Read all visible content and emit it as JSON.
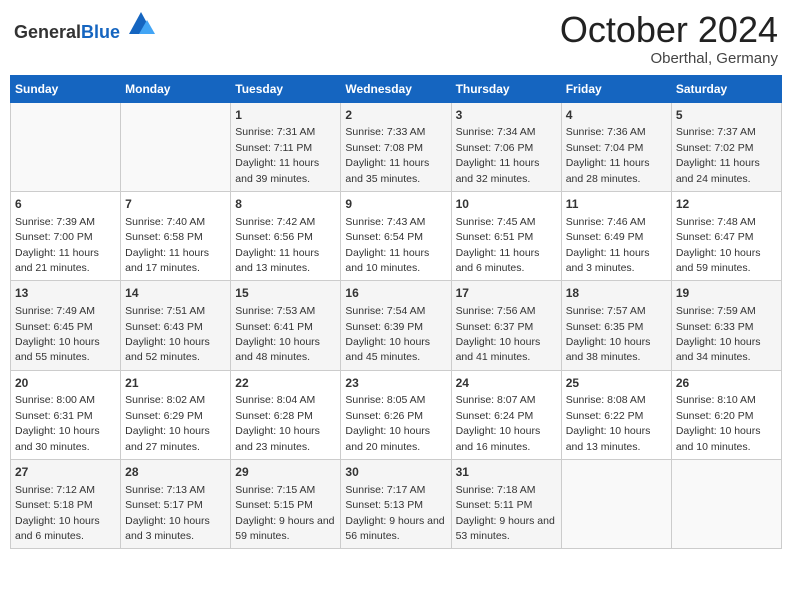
{
  "header": {
    "logo_general": "General",
    "logo_blue": "Blue",
    "month_title": "October 2024",
    "subtitle": "Oberthal, Germany"
  },
  "weekdays": [
    "Sunday",
    "Monday",
    "Tuesday",
    "Wednesday",
    "Thursday",
    "Friday",
    "Saturday"
  ],
  "weeks": [
    [
      {
        "day": "",
        "sunrise": "",
        "sunset": "",
        "daylight": ""
      },
      {
        "day": "",
        "sunrise": "",
        "sunset": "",
        "daylight": ""
      },
      {
        "day": "1",
        "sunrise": "Sunrise: 7:31 AM",
        "sunset": "Sunset: 7:11 PM",
        "daylight": "Daylight: 11 hours and 39 minutes."
      },
      {
        "day": "2",
        "sunrise": "Sunrise: 7:33 AM",
        "sunset": "Sunset: 7:08 PM",
        "daylight": "Daylight: 11 hours and 35 minutes."
      },
      {
        "day": "3",
        "sunrise": "Sunrise: 7:34 AM",
        "sunset": "Sunset: 7:06 PM",
        "daylight": "Daylight: 11 hours and 32 minutes."
      },
      {
        "day": "4",
        "sunrise": "Sunrise: 7:36 AM",
        "sunset": "Sunset: 7:04 PM",
        "daylight": "Daylight: 11 hours and 28 minutes."
      },
      {
        "day": "5",
        "sunrise": "Sunrise: 7:37 AM",
        "sunset": "Sunset: 7:02 PM",
        "daylight": "Daylight: 11 hours and 24 minutes."
      }
    ],
    [
      {
        "day": "6",
        "sunrise": "Sunrise: 7:39 AM",
        "sunset": "Sunset: 7:00 PM",
        "daylight": "Daylight: 11 hours and 21 minutes."
      },
      {
        "day": "7",
        "sunrise": "Sunrise: 7:40 AM",
        "sunset": "Sunset: 6:58 PM",
        "daylight": "Daylight: 11 hours and 17 minutes."
      },
      {
        "day": "8",
        "sunrise": "Sunrise: 7:42 AM",
        "sunset": "Sunset: 6:56 PM",
        "daylight": "Daylight: 11 hours and 13 minutes."
      },
      {
        "day": "9",
        "sunrise": "Sunrise: 7:43 AM",
        "sunset": "Sunset: 6:54 PM",
        "daylight": "Daylight: 11 hours and 10 minutes."
      },
      {
        "day": "10",
        "sunrise": "Sunrise: 7:45 AM",
        "sunset": "Sunset: 6:51 PM",
        "daylight": "Daylight: 11 hours and 6 minutes."
      },
      {
        "day": "11",
        "sunrise": "Sunrise: 7:46 AM",
        "sunset": "Sunset: 6:49 PM",
        "daylight": "Daylight: 11 hours and 3 minutes."
      },
      {
        "day": "12",
        "sunrise": "Sunrise: 7:48 AM",
        "sunset": "Sunset: 6:47 PM",
        "daylight": "Daylight: 10 hours and 59 minutes."
      }
    ],
    [
      {
        "day": "13",
        "sunrise": "Sunrise: 7:49 AM",
        "sunset": "Sunset: 6:45 PM",
        "daylight": "Daylight: 10 hours and 55 minutes."
      },
      {
        "day": "14",
        "sunrise": "Sunrise: 7:51 AM",
        "sunset": "Sunset: 6:43 PM",
        "daylight": "Daylight: 10 hours and 52 minutes."
      },
      {
        "day": "15",
        "sunrise": "Sunrise: 7:53 AM",
        "sunset": "Sunset: 6:41 PM",
        "daylight": "Daylight: 10 hours and 48 minutes."
      },
      {
        "day": "16",
        "sunrise": "Sunrise: 7:54 AM",
        "sunset": "Sunset: 6:39 PM",
        "daylight": "Daylight: 10 hours and 45 minutes."
      },
      {
        "day": "17",
        "sunrise": "Sunrise: 7:56 AM",
        "sunset": "Sunset: 6:37 PM",
        "daylight": "Daylight: 10 hours and 41 minutes."
      },
      {
        "day": "18",
        "sunrise": "Sunrise: 7:57 AM",
        "sunset": "Sunset: 6:35 PM",
        "daylight": "Daylight: 10 hours and 38 minutes."
      },
      {
        "day": "19",
        "sunrise": "Sunrise: 7:59 AM",
        "sunset": "Sunset: 6:33 PM",
        "daylight": "Daylight: 10 hours and 34 minutes."
      }
    ],
    [
      {
        "day": "20",
        "sunrise": "Sunrise: 8:00 AM",
        "sunset": "Sunset: 6:31 PM",
        "daylight": "Daylight: 10 hours and 30 minutes."
      },
      {
        "day": "21",
        "sunrise": "Sunrise: 8:02 AM",
        "sunset": "Sunset: 6:29 PM",
        "daylight": "Daylight: 10 hours and 27 minutes."
      },
      {
        "day": "22",
        "sunrise": "Sunrise: 8:04 AM",
        "sunset": "Sunset: 6:28 PM",
        "daylight": "Daylight: 10 hours and 23 minutes."
      },
      {
        "day": "23",
        "sunrise": "Sunrise: 8:05 AM",
        "sunset": "Sunset: 6:26 PM",
        "daylight": "Daylight: 10 hours and 20 minutes."
      },
      {
        "day": "24",
        "sunrise": "Sunrise: 8:07 AM",
        "sunset": "Sunset: 6:24 PM",
        "daylight": "Daylight: 10 hours and 16 minutes."
      },
      {
        "day": "25",
        "sunrise": "Sunrise: 8:08 AM",
        "sunset": "Sunset: 6:22 PM",
        "daylight": "Daylight: 10 hours and 13 minutes."
      },
      {
        "day": "26",
        "sunrise": "Sunrise: 8:10 AM",
        "sunset": "Sunset: 6:20 PM",
        "daylight": "Daylight: 10 hours and 10 minutes."
      }
    ],
    [
      {
        "day": "27",
        "sunrise": "Sunrise: 7:12 AM",
        "sunset": "Sunset: 5:18 PM",
        "daylight": "Daylight: 10 hours and 6 minutes."
      },
      {
        "day": "28",
        "sunrise": "Sunrise: 7:13 AM",
        "sunset": "Sunset: 5:17 PM",
        "daylight": "Daylight: 10 hours and 3 minutes."
      },
      {
        "day": "29",
        "sunrise": "Sunrise: 7:15 AM",
        "sunset": "Sunset: 5:15 PM",
        "daylight": "Daylight: 9 hours and 59 minutes."
      },
      {
        "day": "30",
        "sunrise": "Sunrise: 7:17 AM",
        "sunset": "Sunset: 5:13 PM",
        "daylight": "Daylight: 9 hours and 56 minutes."
      },
      {
        "day": "31",
        "sunrise": "Sunrise: 7:18 AM",
        "sunset": "Sunset: 5:11 PM",
        "daylight": "Daylight: 9 hours and 53 minutes."
      },
      {
        "day": "",
        "sunrise": "",
        "sunset": "",
        "daylight": ""
      },
      {
        "day": "",
        "sunrise": "",
        "sunset": "",
        "daylight": ""
      }
    ]
  ]
}
